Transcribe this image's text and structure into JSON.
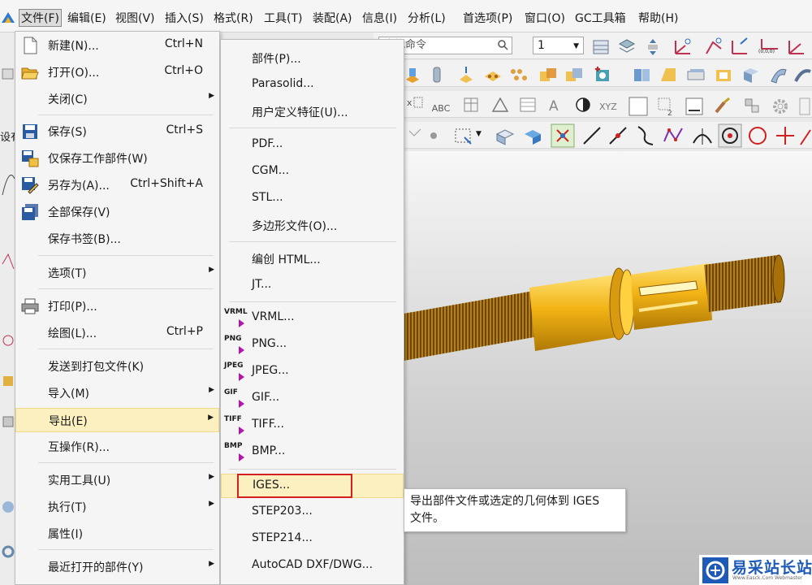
{
  "menubar": {
    "items": [
      {
        "label": "文件(F)",
        "active": true
      },
      {
        "label": "编辑(E)"
      },
      {
        "label": "视图(V)"
      },
      {
        "label": "插入(S)"
      },
      {
        "label": "格式(R)"
      },
      {
        "label": "工具(T)"
      },
      {
        "label": "装配(A)"
      },
      {
        "label": "信息(I)"
      },
      {
        "label": "分析(L)"
      },
      {
        "label": "首选项(P)"
      },
      {
        "label": "窗口(O)"
      },
      {
        "label": "GC工具箱"
      },
      {
        "label": "帮助(H)"
      }
    ]
  },
  "toolbar": {
    "command_finder_text": "查找命令",
    "selection_value": "1",
    "abc_label": "ABC",
    "xyz_label": "XYZ",
    "coord_label": "(0,0,0)"
  },
  "left_strip": {
    "partial_label": "设有"
  },
  "file_menu": {
    "items": [
      {
        "label": "新建(N)...",
        "shortcut": "Ctrl+N",
        "icon": "new-document-icon"
      },
      {
        "label": "打开(O)...",
        "shortcut": "Ctrl+O",
        "icon": "open-folder-icon"
      },
      {
        "label": "关闭(C)",
        "submenu": true
      },
      {
        "label": "保存(S)",
        "shortcut": "Ctrl+S",
        "icon": "save-icon"
      },
      {
        "label": "仅保存工作部件(W)",
        "icon": "save-work-part-icon"
      },
      {
        "label": "另存为(A)...",
        "shortcut": "Ctrl+Shift+A",
        "icon": "save-as-icon"
      },
      {
        "label": "全部保存(V)",
        "icon": "save-all-icon"
      },
      {
        "label": "保存书签(B)..."
      },
      {
        "label": "选项(T)",
        "submenu": true
      },
      {
        "label": "打印(P)...",
        "icon": "printer-icon"
      },
      {
        "label": "绘图(L)...",
        "shortcut": "Ctrl+P"
      },
      {
        "label": "发送到打包文件(K)"
      },
      {
        "label": "导入(M)",
        "submenu": true
      },
      {
        "label": "导出(E)",
        "submenu": true,
        "highlighted": true
      },
      {
        "label": "互操作(R)..."
      },
      {
        "label": "实用工具(U)",
        "submenu": true
      },
      {
        "label": "执行(T)",
        "submenu": true
      },
      {
        "label": "属性(I)"
      },
      {
        "label": "最近打开的部件(Y)",
        "submenu": true
      }
    ]
  },
  "export_menu": {
    "items": [
      {
        "label": "部件(P)..."
      },
      {
        "label": "Parasolid..."
      },
      {
        "label": "用户定义特征(U)..."
      },
      {
        "label": "PDF..."
      },
      {
        "label": "CGM..."
      },
      {
        "label": "STL..."
      },
      {
        "label": "多边形文件(O)..."
      },
      {
        "label": "编创 HTML..."
      },
      {
        "label": "JT..."
      },
      {
        "label": "VRML...",
        "format": "VRML"
      },
      {
        "label": "PNG...",
        "format": "PNG"
      },
      {
        "label": "JPEG...",
        "format": "JPEG"
      },
      {
        "label": "GIF...",
        "format": "GIF"
      },
      {
        "label": "TIFF...",
        "format": "TIFF"
      },
      {
        "label": "BMP...",
        "format": "BMP"
      },
      {
        "label": "IGES...",
        "highlighted": true
      },
      {
        "label": "STEP203..."
      },
      {
        "label": "STEP214..."
      },
      {
        "label": "AutoCAD DXF/DWG..."
      }
    ]
  },
  "tooltip": {
    "text_line1": "导出部件文件或选定的几何体到 IGES",
    "text_line2": "文件。"
  },
  "watermark": {
    "title": "易采站长站",
    "subtitle": "Www.Easck.Com Webmaster"
  },
  "colors": {
    "highlight_bg": "#fcefc0",
    "highlight_border": "#efd98a",
    "callout_red": "#d32020",
    "format_arrow": "#b016a8",
    "part_gold": "#f2b315",
    "watermark_blue": "#1e5bb8"
  }
}
